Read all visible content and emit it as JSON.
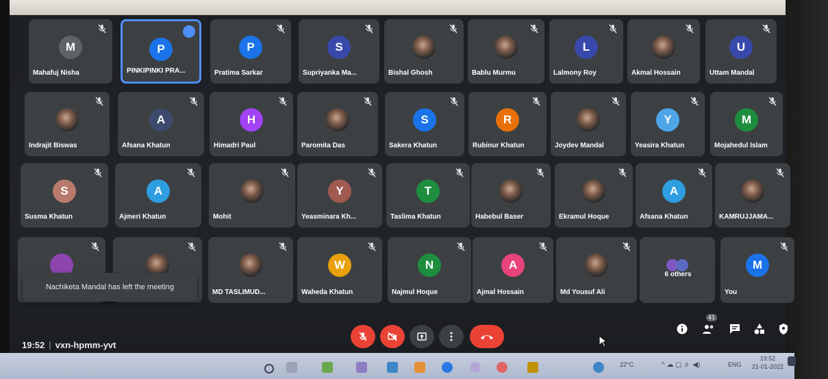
{
  "participants": [
    {
      "name": "Mahafuj Nisha",
      "initial": "M",
      "color": "#5f6368",
      "photo": false
    },
    {
      "name": "PINKIPINKI PRA...",
      "initial": "P",
      "color": "#1a73e8",
      "photo": false,
      "active": true
    },
    {
      "name": "Pratima Sarkar",
      "initial": "P",
      "color": "#1a73e8",
      "photo": false
    },
    {
      "name": "Supriyanka Ma...",
      "initial": "S",
      "color": "#3949ab",
      "photo": false
    },
    {
      "name": "Bishal Ghosh",
      "initial": "",
      "color": "#444",
      "photo": true
    },
    {
      "name": "Bablu Murmu",
      "initial": "",
      "color": "#444",
      "photo": true
    },
    {
      "name": "Lalmony Roy",
      "initial": "L",
      "color": "#3949ab",
      "photo": false
    },
    {
      "name": "Akmal Hossain",
      "initial": "",
      "color": "#444",
      "photo": true
    },
    {
      "name": "Uttam Mandal",
      "initial": "U",
      "color": "#3949ab",
      "photo": false
    },
    {
      "name": "Indrajit Biswas",
      "initial": "",
      "color": "#444",
      "photo": true
    },
    {
      "name": "Afsana Khatun",
      "initial": "A",
      "color": "#3c4a6b",
      "photo": false
    },
    {
      "name": "Himadri Paul",
      "initial": "H",
      "color": "#a142f4",
      "photo": false
    },
    {
      "name": "Paromita Das",
      "initial": "",
      "color": "#444",
      "photo": true
    },
    {
      "name": "Sakera Khatun",
      "initial": "S",
      "color": "#1a73e8",
      "photo": false
    },
    {
      "name": "Rubinur Khatun",
      "initial": "R",
      "color": "#e8710a",
      "photo": false
    },
    {
      "name": "Joydev Mandal",
      "initial": "",
      "color": "#444",
      "photo": true
    },
    {
      "name": "Yeasira Khatun",
      "initial": "Y",
      "color": "#4ea6e8",
      "photo": false
    },
    {
      "name": "Mojahedul Islam",
      "initial": "M",
      "color": "#1e8e3e",
      "photo": false
    },
    {
      "name": "Susma Khatun",
      "initial": "S",
      "color": "#b97a6e",
      "photo": false
    },
    {
      "name": "Ajmeri Khatun",
      "initial": "A",
      "color": "#2d9fe0",
      "photo": false
    },
    {
      "name": "Mohit",
      "initial": "",
      "color": "#444",
      "photo": true
    },
    {
      "name": "Yeasminara Kh...",
      "initial": "Y",
      "color": "#a05a4f",
      "photo": false
    },
    {
      "name": "Taslima Khatun",
      "initial": "T",
      "color": "#1e8e3e",
      "photo": false
    },
    {
      "name": "Habebul Baser",
      "initial": "",
      "color": "#444",
      "photo": true
    },
    {
      "name": "Ekramul Hoque",
      "initial": "",
      "color": "#444",
      "photo": true
    },
    {
      "name": "Afsana Khatun",
      "initial": "A",
      "color": "#2d9fe0",
      "photo": false
    },
    {
      "name": "KAMRUJJAMA...",
      "initial": "",
      "color": "#444",
      "photo": true
    },
    {
      "name": "",
      "initial": "",
      "color": "#8e44ad",
      "photo": false,
      "hidden": true
    },
    {
      "name": "",
      "initial": "",
      "color": "#444",
      "photo": true,
      "hidden": true
    },
    {
      "name": "MD TASLIMUD...",
      "initial": "",
      "color": "#444",
      "photo": true
    },
    {
      "name": "Waheda Khatun",
      "initial": "W",
      "color": "#e8a10a",
      "photo": false
    },
    {
      "name": "Najmul Hoque",
      "initial": "N",
      "color": "#1e8e3e",
      "photo": false
    },
    {
      "name": "Ajmal Hossain",
      "initial": "A",
      "color": "#e8437b",
      "photo": false
    },
    {
      "name": "Md Yousuf Ali",
      "initial": "",
      "color": "#444",
      "photo": true
    },
    {
      "name": "6 others",
      "initial": "",
      "color": "#444",
      "photo": false,
      "others": true
    },
    {
      "name": "You",
      "initial": "M",
      "color": "#1a73e8",
      "photo": false
    }
  ],
  "toast": "Nachiketa Mandal has left the meeting",
  "meeting": {
    "time": "19:52",
    "code": "vxn-hpmm-yvt",
    "separator": "|"
  },
  "people_count": "41",
  "tray": {
    "temp": "22°C",
    "lang": "ENG",
    "time": "19:52",
    "date": "21-01-2022"
  },
  "colors": {
    "end_call": "#ea4335",
    "highlight": "#4f8ff7",
    "tile": "#3c4043"
  }
}
